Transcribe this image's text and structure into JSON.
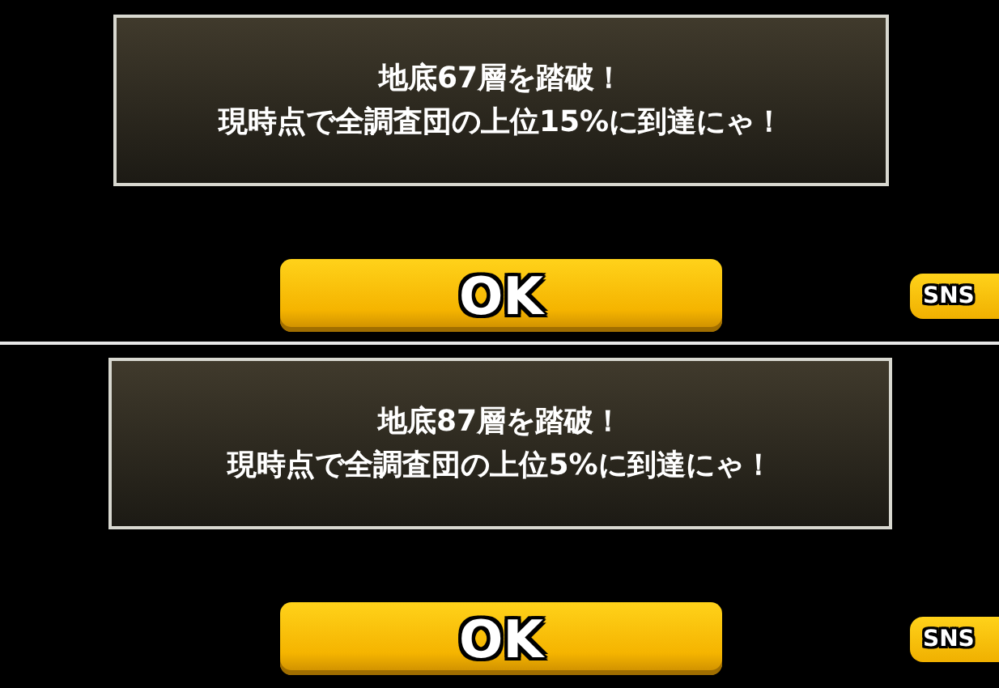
{
  "screens": [
    {
      "message_lines": [
        "地底67層を踏破！",
        "現時点で全調査団の上位15%に到達にゃ！"
      ],
      "ok_button": "OK",
      "sns_button": "SNS"
    },
    {
      "message_lines": [
        "地底87層を踏破！",
        "現時点で全調査団の上位5%に到達にゃ！"
      ],
      "ok_button": "OK",
      "sns_button": "SNS"
    }
  ]
}
